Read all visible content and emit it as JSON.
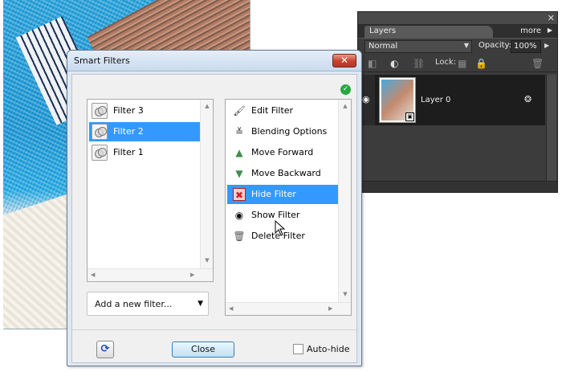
{
  "layers_panel": {
    "close_glyph": "✕",
    "tab_label": "Layers",
    "more_label": "more",
    "blend_mode": "Normal",
    "opacity_label": "Opacity:",
    "opacity_value": "100%",
    "lock_label": "Lock:",
    "layer_name": "Layer 0"
  },
  "dialog": {
    "title": "Smart Filters",
    "close_glyph": "✕",
    "filters": [
      {
        "label": "Filter 3",
        "selected": false
      },
      {
        "label": "Filter 2",
        "selected": true
      },
      {
        "label": "Filter 1",
        "selected": false
      }
    ],
    "add_filter_label": "Add a new filter...",
    "actions": [
      {
        "label": "Edit Filter",
        "icon": "brush-icon",
        "glyph": "🖌",
        "color": "#333333"
      },
      {
        "label": "Blending Options",
        "icon": "blend-options-icon",
        "glyph": "≚",
        "color": "#333333"
      },
      {
        "label": "Move Forward",
        "icon": "triangle-up-icon",
        "glyph": "▲",
        "color": "#3e8e4e"
      },
      {
        "label": "Move Backward",
        "icon": "triangle-down-icon",
        "glyph": "▼",
        "color": "#3e8e4e"
      },
      {
        "label": "Hide Filter",
        "icon": "hide-eye-icon",
        "glyph": "✖",
        "color": "#cc2222",
        "selected": true
      },
      {
        "label": "Show Filter",
        "icon": "eye-icon",
        "glyph": "◉",
        "color": "#111111"
      },
      {
        "label": "Delete Filter",
        "icon": "trash-icon",
        "glyph": "🗑",
        "color": "#555555"
      }
    ],
    "close_button_label": "Close",
    "autohide_label": "Auto-hide"
  },
  "colors": {
    "selection": "#3399ff",
    "close_button": "#c7412c",
    "ok_check": "#27a843"
  }
}
